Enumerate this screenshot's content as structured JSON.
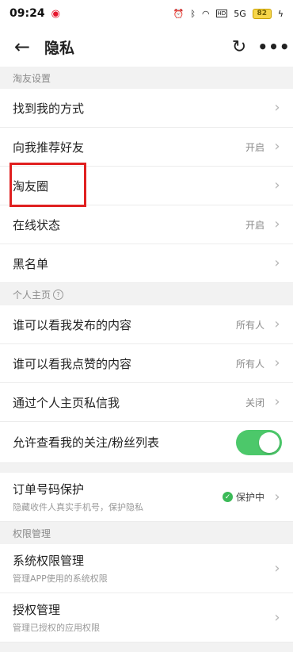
{
  "status_bar": {
    "time": "09:24",
    "network": "5G",
    "battery": "82",
    "icons": [
      "weibo-icon",
      "alarm-icon",
      "bluetooth-icon",
      "wifi-icon",
      "hd-icon",
      "battery-icon",
      "charging-icon"
    ]
  },
  "header": {
    "title": "隐私",
    "back_icon": "←",
    "refresh_icon": "↻",
    "more_icon": "•••"
  },
  "sections": {
    "friends_header": "淘友设置",
    "friends": [
      {
        "label": "找到我的方式",
        "value": ""
      },
      {
        "label": "向我推荐好友",
        "value": "开启"
      },
      {
        "label": "淘友圈",
        "value": ""
      },
      {
        "label": "在线状态",
        "value": "开启"
      },
      {
        "label": "黑名单",
        "value": ""
      }
    ],
    "homepage_header": "个人主页",
    "homepage": [
      {
        "label": "谁可以看我发布的内容",
        "value": "所有人"
      },
      {
        "label": "谁可以看我点赞的内容",
        "value": "所有人"
      },
      {
        "label": "通过个人主页私信我",
        "value": "关闭"
      },
      {
        "label": "允许查看我的关注/粉丝列表",
        "toggle": true
      }
    ],
    "order": {
      "label": "订单号码保护",
      "sub": "隐藏收件人真实手机号，保护隐私",
      "value": "保护中"
    },
    "permissions_header": "权限管理",
    "permissions": [
      {
        "label": "系统权限管理",
        "sub": "管理APP使用的系统权限"
      },
      {
        "label": "授权管理",
        "sub": "管理已授权的应用权限"
      }
    ]
  },
  "colors": {
    "accent_green": "#4cc86a",
    "highlight_red": "#e02020"
  }
}
